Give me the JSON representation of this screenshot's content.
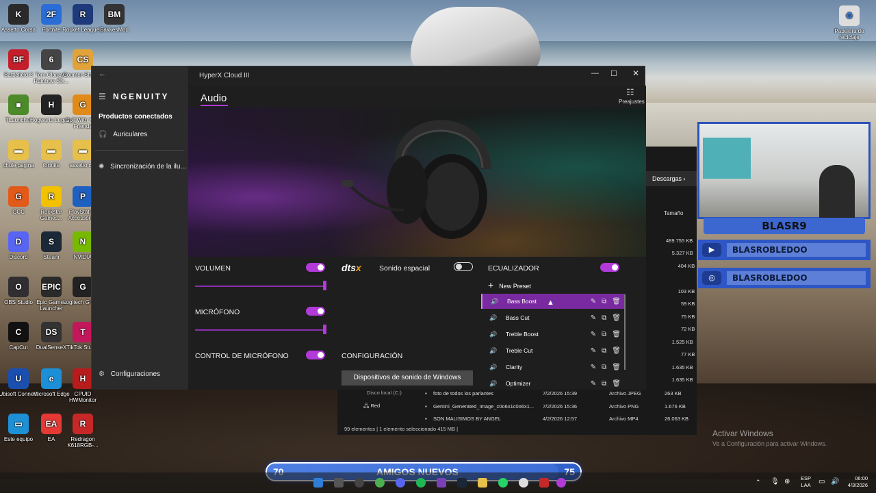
{
  "desktop_icons": [
    {
      "label": "Assetto Corsa",
      "glyph": "K",
      "color": "#2a2a2a"
    },
    {
      "label": "Fortnite",
      "glyph": "2F",
      "color": "#2b6dd6"
    },
    {
      "label": "Rocket League®",
      "glyph": "R",
      "color": "#1e3a7a"
    },
    {
      "label": "BakkesMod",
      "glyph": "BM",
      "color": "#333"
    },
    {
      "label": "Battlefield 3",
      "glyph": "BF",
      "color": "#c21f2a"
    },
    {
      "label": "Tom Clancy's Rainbow Six...",
      "glyph": "6",
      "color": "#444"
    },
    {
      "label": "Counter-Strike 2",
      "glyph": "CS",
      "color": "#e0a23a"
    },
    {
      "label": "TLauncher",
      "glyph": "■",
      "color": "#4c8a2a"
    },
    {
      "label": "Hogwarts Legacy",
      "glyph": "H",
      "color": "#222"
    },
    {
      "label": "Golf With Your Friends",
      "glyph": "G",
      "color": "#e08a1a"
    },
    {
      "label": "chule pagina",
      "glyph": "▬",
      "color": "#e6c04a"
    },
    {
      "label": "fortnite",
      "glyph": "▬",
      "color": "#e6c04a"
    },
    {
      "label": "assetto c...",
      "glyph": "▬",
      "color": "#e6c04a"
    },
    {
      "label": "GCC",
      "glyph": "G",
      "color": "#e25a1a"
    },
    {
      "label": "Rockstar Games...",
      "glyph": "R",
      "color": "#f2c200"
    },
    {
      "label": "PlayStation Accessories",
      "glyph": "P",
      "color": "#1f5fbf"
    },
    {
      "label": "Discord",
      "glyph": "D",
      "color": "#5865f2"
    },
    {
      "label": "Steam",
      "glyph": "S",
      "color": "#1b2838"
    },
    {
      "label": "NVIDIA",
      "glyph": "N",
      "color": "#76b900"
    },
    {
      "label": "OBS Studio",
      "glyph": "O",
      "color": "#302e31"
    },
    {
      "label": "Epic Games Launcher",
      "glyph": "EPIC",
      "color": "#2a2a2a"
    },
    {
      "label": "Logitech G HUB",
      "glyph": "G",
      "color": "#222"
    },
    {
      "label": "CapCut",
      "glyph": "C",
      "color": "#111"
    },
    {
      "label": "DualSenseX",
      "glyph": "DS",
      "color": "#333"
    },
    {
      "label": "TikTok Studio",
      "glyph": "T",
      "color": "#c2185b"
    },
    {
      "label": "Ubisoft Connect",
      "glyph": "U",
      "color": "#1a4fb0"
    },
    {
      "label": "Microsoft Edge",
      "glyph": "e",
      "color": "#1c8fd6"
    },
    {
      "label": "CPUID HWMonitor",
      "glyph": "H",
      "color": "#b71c1c"
    },
    {
      "label": "Este equipo",
      "glyph": "▭",
      "color": "#1e90d6"
    },
    {
      "label": "EA",
      "glyph": "EA",
      "color": "#e53935"
    },
    {
      "label": "Redragon K618RGB-...",
      "glyph": "R",
      "color": "#c62828"
    }
  ],
  "recycle_bin": {
    "label": "Papelera de reciclaje"
  },
  "app": {
    "window_title": "HyperX Cloud III",
    "brand": "NGENUITY",
    "connected_heading": "Productos conectados",
    "nav": [
      {
        "label": "Auriculares",
        "icon": "headset-icon"
      },
      {
        "label": "Sincronización de la ilu...",
        "icon": "sync-light-icon"
      }
    ],
    "settings_label": "Configuraciones",
    "page_title": "Audio",
    "presets_label": "Preajustes"
  },
  "controls": {
    "volume": {
      "label": "VOLUMEN",
      "enabled": true,
      "level": 1.0
    },
    "mic": {
      "label": "MICRÓFONO",
      "enabled": true,
      "level": 1.0
    },
    "mic_control": {
      "label": "CONTROL DE MICRÓFONO",
      "enabled": true
    },
    "dts": {
      "logo": "dts",
      "logo_suffix": "x",
      "label": "Sonido espacial",
      "enabled": false
    },
    "config": {
      "label": "CONFIGURACIÓN",
      "button": "Dispositivos de sonido de Windows"
    },
    "eq": {
      "label": "ECUALIZADOR",
      "enabled": true,
      "new_preset": "New Preset",
      "presets": [
        "Bass Boost",
        "Bass Cut",
        "Treble Boost",
        "Treble Cut",
        "Clarity",
        "Optimizer"
      ],
      "selected": "Bass Boost"
    }
  },
  "explorer": {
    "breadcrumb": "Descargas",
    "size_header": "Tamaño",
    "sizes": [
      "489.755 KB",
      "5.327 KB",
      "404 KB",
      "103 KB",
      "59 KB",
      "75 KB",
      "72 KB",
      "1.525 KB",
      "77 KB",
      "1.635 KB",
      "1.635 KB"
    ],
    "tree": [
      "Disco local (C:)",
      "Red"
    ],
    "files": [
      {
        "name": "foto de todos los parlantes",
        "date": "7/2/2026 15:39",
        "type": "Archivo JPEG",
        "size": "263 KB"
      },
      {
        "name": "Gemini_Generated_Image_c0o6x1c0o6x1...",
        "date": "7/2/2026 15:36",
        "type": "Archivo PNG",
        "size": "1.676 KB"
      },
      {
        "name": "SON MALISIMOS BY ANGEL",
        "date": "4/2/2026 12:57",
        "type": "Archivo MP4",
        "size": "26.063 KB"
      }
    ],
    "status": "99 elementos   |   1 elemento seleccionado  415 MB   |"
  },
  "stream": {
    "name": "BLASR9",
    "socials": [
      {
        "icon": "youtube-icon",
        "glyph": "▶",
        "text": "BLASROBLEDOO"
      },
      {
        "icon": "instagram-icon",
        "glyph": "◎",
        "text": "BLASROBLEDOO"
      }
    ],
    "goal": {
      "current": "70",
      "label": "AMIGOS NUEVOS",
      "target": "75",
      "progress": 0.93
    }
  },
  "watermark": {
    "title": "Activar Windows",
    "subtitle": "Ve a Configuración para activar Windows."
  },
  "taskbar": {
    "lang": "ESP",
    "region": "LAA",
    "time": "06:00",
    "date": "4/3/2026"
  }
}
